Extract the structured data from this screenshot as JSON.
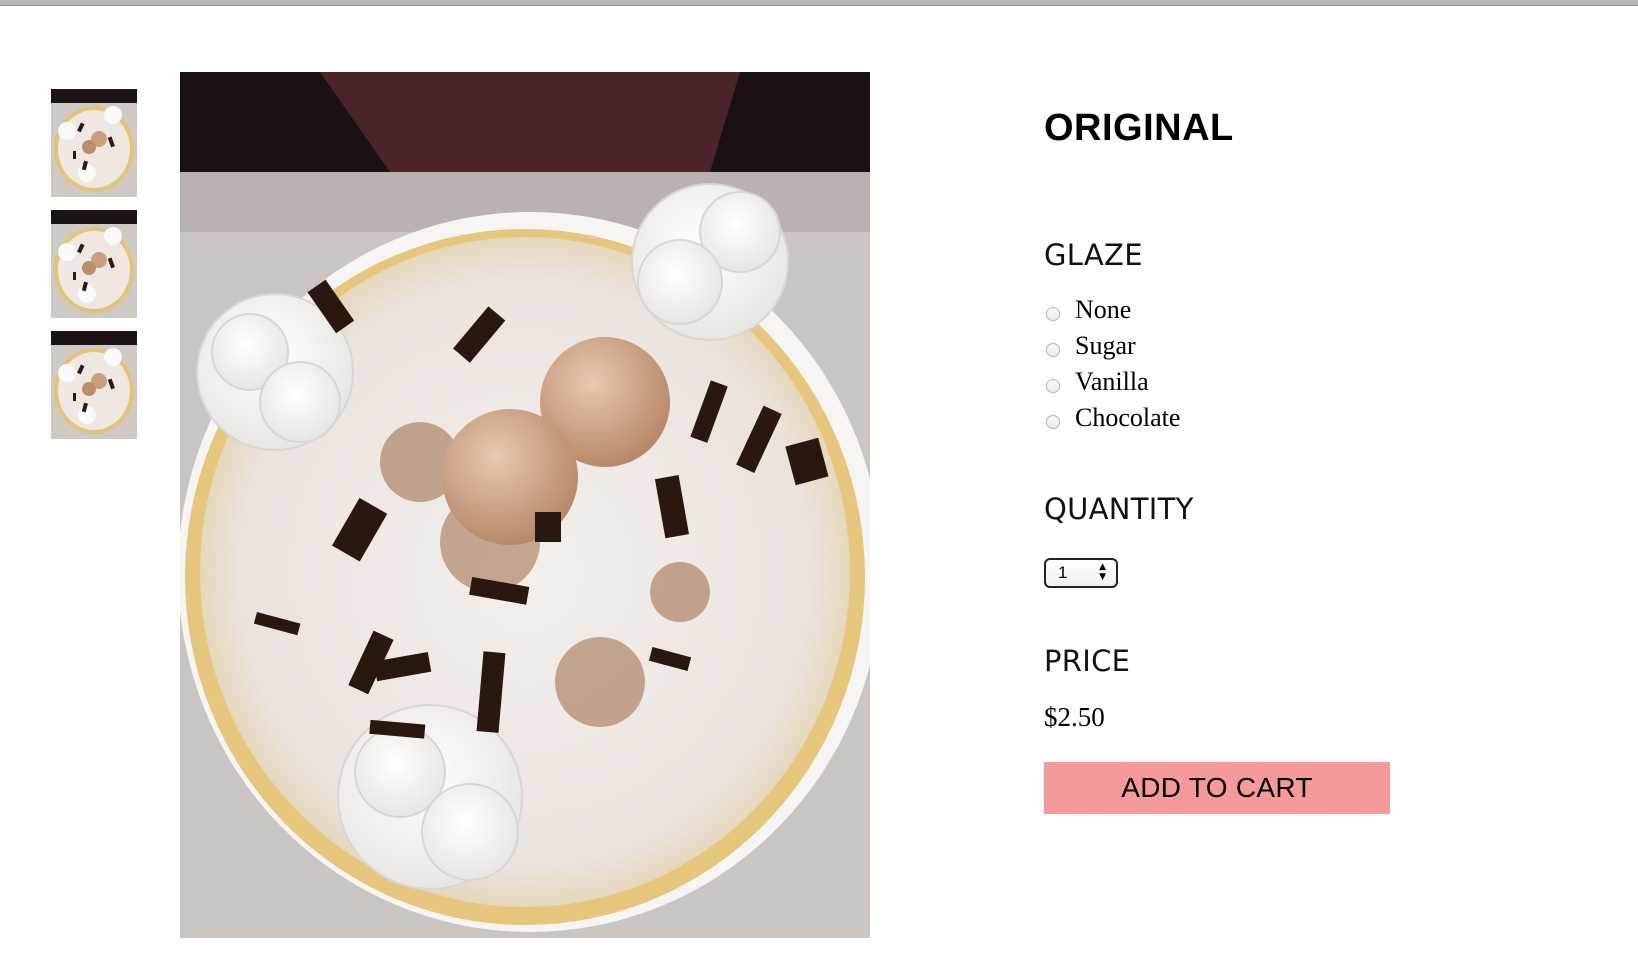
{
  "product": {
    "title": "ORIGINAL"
  },
  "gallery": {
    "thumbnails": [
      "crepe-photo",
      "crepe-photo",
      "crepe-photo"
    ],
    "main_image": "crepe-photo"
  },
  "glaze": {
    "heading": "GLAZE",
    "options": [
      "None",
      "Sugar",
      "Vanilla",
      "Chocolate"
    ]
  },
  "quantity": {
    "heading": "QUANTITY",
    "value": "1"
  },
  "price": {
    "heading": "PRICE",
    "value": "$2.50"
  },
  "cart": {
    "button_label": "ADD TO CART"
  },
  "colors": {
    "button_bg": "#f49a9a",
    "border_top": "#b8b8b8"
  }
}
